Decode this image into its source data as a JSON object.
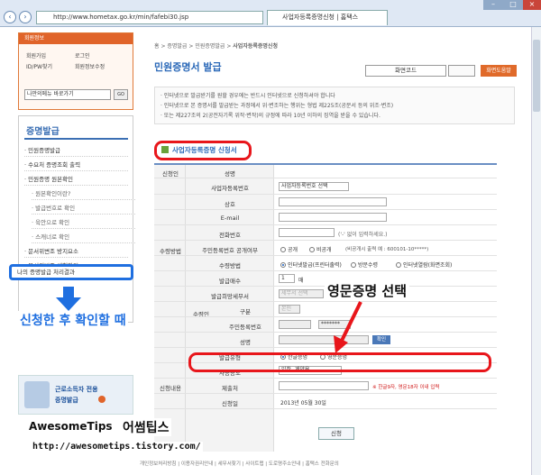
{
  "browser": {
    "url": "http://www.hometax.go.kr/min/fafebi30.jsp",
    "tab_title": "사업자등록증명신청 | 홈택스"
  },
  "sidebar": {
    "login_header": "회원정보",
    "login_links": [
      "회원가입",
      "로그인",
      "ID/PW찾기",
      "회원정보수정"
    ],
    "quick_select": "나만의메뉴 바로가기",
    "quick_go": "GO",
    "menu_title": "증명발급",
    "items": [
      {
        "label": "민원증명발급",
        "sub": false
      },
      {
        "label": "수요처 증명조회 출력",
        "sub": false
      },
      {
        "label": "민원증명 원본확인",
        "sub": false
      },
      {
        "label": "원본확인이란?",
        "sub": true
      },
      {
        "label": "발급번호로 확인",
        "sub": true
      },
      {
        "label": "육안으로 확인",
        "sub": true
      },
      {
        "label": "스캐너로 확인",
        "sub": true
      },
      {
        "label": "문서위변조 방지요소",
        "sub": false
      },
      {
        "label": "문서위변조 체험하기",
        "sub": false
      }
    ],
    "highlighted_item": "나의 증명발급 처리결과",
    "banner_text1": "근로소득자 전용",
    "banner_text2": "증명발급"
  },
  "annotation": {
    "left_text": "신청한 후 확인할 때",
    "right_text": "영문증명 선택",
    "site_name": "AwesomeTips",
    "site_korean": "어썸팁스",
    "site_url": "http://awesometips.tistory.com/"
  },
  "main": {
    "breadcrumb": [
      "홈",
      "증명발급",
      "민원증명발급",
      "사업자등록증명신청"
    ],
    "page_title": "민원증명서 발급",
    "top_right_label": "화면코드",
    "top_right_help": "화면도움말",
    "notice": [
      "· 인터넷으로 발급받기를 원할 경우에는 반드시 인터넷으로 신청하셔야 합니다",
      "· 인터넷으로 본 증명서를 발급받는 과정에서 위·변조하는 행위는 형법 제225조(공문서 등의 위조·변조)",
      "· 또는 제227조의 2(공전자기록 위작·변작)의 규정에 따라 10년 이하의 징역을 받을 수 있습니다."
    ],
    "form_heading": "사업자등록증명 신청서",
    "group_applicant": "신청인",
    "group_receive": "수령방법",
    "group_recipient": "수령인",
    "group_content": "신청내용",
    "rows": {
      "name": "성명",
      "bizno_label": "사업자등록번호",
      "bizno_select": "사업자등록번호 선택",
      "company": "상호",
      "email": "E-mail",
      "phone": "전화번호",
      "phone_hint": "('-' 없이 입력하세요.)",
      "id_public": "주민등록번호 공개여부",
      "public": "공개",
      "private": "비공개",
      "private_note": "(비공개시 출력 예 : 600101-10*****)",
      "receive_label": "수령방법",
      "receive_opts": [
        "인터넷발급(프린터출력)",
        "방문수령",
        "인터넷열람(화면조회)"
      ],
      "copies_label": "발급매수",
      "copies_value": "1",
      "copies_unit": "매",
      "office_label": "발급희망세무서",
      "office_value": "세무서 선택",
      "relation_label": "구분",
      "relation_value": "본인",
      "recipient_id_label": "주민등록번호",
      "recipient_id_mask": "*******",
      "recipient_name_label": "성명",
      "confirm": "확인",
      "type_label": "발급유형",
      "type_korean": "한글증명",
      "type_english": "영문증명",
      "purpose_label": "사용용도",
      "purpose_value": "입찰, 계약용",
      "submit_label": "제출처",
      "submit_note": "※ 한글9자, 영문18자 이내 입력",
      "date_label": "신청일",
      "date_value": "2013년 05월 30일"
    },
    "apply_button": "신청",
    "footer": [
      "개인정보처리방침",
      "이용자권리안내",
      "세무서찾기",
      "사이트맵",
      "도로명주소안내",
      "홈택스 전화문의"
    ]
  }
}
